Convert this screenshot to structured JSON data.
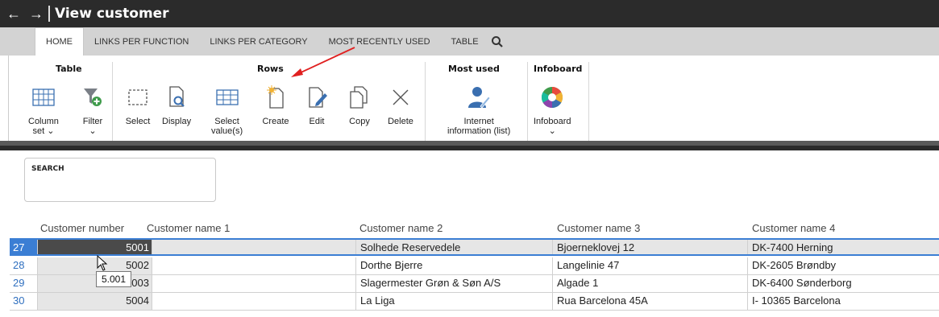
{
  "titlebar": {
    "back_icon": "arrow-left-icon",
    "forward_icon": "arrow-right-icon",
    "title": "View customer"
  },
  "tabs": [
    {
      "label": "HOME",
      "active": true
    },
    {
      "label": "LINKS PER FUNCTION",
      "active": false
    },
    {
      "label": "LINKS PER CATEGORY",
      "active": false
    },
    {
      "label": "MOST RECENTLY USED",
      "active": false
    },
    {
      "label": "TABLE",
      "active": false
    }
  ],
  "ribbon": {
    "groups": {
      "table": "Table",
      "rows": "Rows",
      "most_used": "Most used",
      "infoboard": "Infoboard"
    },
    "buttons": {
      "column_set": {
        "line1": "Column",
        "line2": "set",
        "icon": "column-set-icon"
      },
      "filter": {
        "label": "Filter",
        "icon": "filter-add-icon"
      },
      "select": {
        "label": "Select",
        "icon": "select-icon"
      },
      "display": {
        "label": "Display",
        "icon": "display-icon"
      },
      "select_values": {
        "line1": "Select",
        "line2": "value(s)",
        "icon": "table-grid-icon"
      },
      "create": {
        "label": "Create",
        "icon": "new-document-icon"
      },
      "edit": {
        "label": "Edit",
        "icon": "edit-document-icon"
      },
      "copy": {
        "label": "Copy",
        "icon": "copy-document-icon"
      },
      "delete": {
        "label": "Delete",
        "icon": "close-icon"
      },
      "internet_info": {
        "line1": "Internet",
        "line2": "information (list)",
        "icon": "user-link-icon"
      },
      "infoboard": {
        "label": "Infoboard",
        "icon": "infoboard-wheel-icon"
      }
    },
    "chevron": "⌄"
  },
  "search": {
    "label": "SEARCH"
  },
  "table": {
    "columns": [
      "Customer number",
      "Customer name 1",
      "Customer name 2",
      "Customer name 3",
      "Customer name 4"
    ],
    "rows": [
      {
        "num": "27",
        "customer_number": "5001",
        "name1": "",
        "name2": "Solhede Reservedele",
        "name3": "Bjoerneklovej 12",
        "name4": "DK-7400  Herning",
        "selected": true
      },
      {
        "num": "28",
        "customer_number": "5002",
        "name1": "",
        "name2": "Dorthe Bjerre",
        "name3": "Langelinie 47",
        "name4": "DK-2605  Brøndby",
        "selected": false
      },
      {
        "num": "29",
        "customer_number": "5003",
        "name1": "",
        "name2": "Slagermester Grøn & Søn A/S",
        "name3": "Algade 1",
        "name4": "DK-6400  Sønderborg",
        "selected": false
      },
      {
        "num": "30",
        "customer_number": "5004",
        "name1": "",
        "name2": "La Liga",
        "name3": "Rua Barcelona 45A",
        "name4": "I- 10365 Barcelona",
        "selected": false
      }
    ]
  },
  "tooltip": {
    "text": "5.001"
  },
  "colors": {
    "titlebar": "#2b2b2b",
    "tabs_bg": "#d3d3d3",
    "selection": "#3b7ed4",
    "annotation_arrow": "#e02020"
  }
}
